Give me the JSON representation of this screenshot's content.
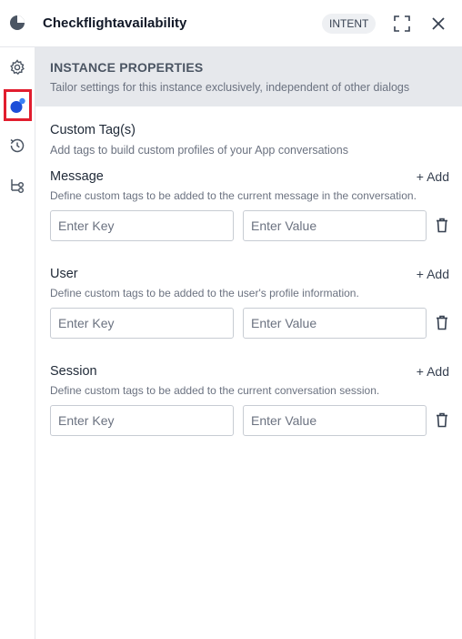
{
  "header": {
    "title": "Checkflightavailability",
    "badge": "INTENT",
    "icons": [
      "pie-chart-icon",
      "expand-icon",
      "close-icon"
    ]
  },
  "rail": {
    "items": [
      {
        "name": "settings",
        "icon": "gear-icon"
      },
      {
        "name": "instance-properties",
        "icon": "bubbles-icon",
        "active": true
      },
      {
        "name": "history",
        "icon": "history-icon"
      },
      {
        "name": "flow",
        "icon": "branch-icon"
      }
    ],
    "highlight_color": "#e11d2e",
    "accent": "#2563eb"
  },
  "banner": {
    "heading": "INSTANCE PROPERTIES",
    "subtext": "Tailor settings for this instance exclusively, independent of other dialogs"
  },
  "custom_tags": {
    "title": "Custom Tag(s)",
    "subtitle": "Add tags to build custom profiles of your App conversations",
    "groups": [
      {
        "title": "Message",
        "add_label": "+ Add",
        "description": "Define custom tags to be added to the current message in the conversation.",
        "key_placeholder": "Enter Key",
        "value_placeholder": "Enter Value"
      },
      {
        "title": "User",
        "add_label": "+ Add",
        "description": "Define custom tags to be added to the user's profile information.",
        "key_placeholder": "Enter Key",
        "value_placeholder": "Enter Value"
      },
      {
        "title": "Session",
        "add_label": "+ Add",
        "description": "Define custom tags to be added to the current conversation session.",
        "key_placeholder": "Enter Key",
        "value_placeholder": "Enter Value"
      }
    ]
  }
}
